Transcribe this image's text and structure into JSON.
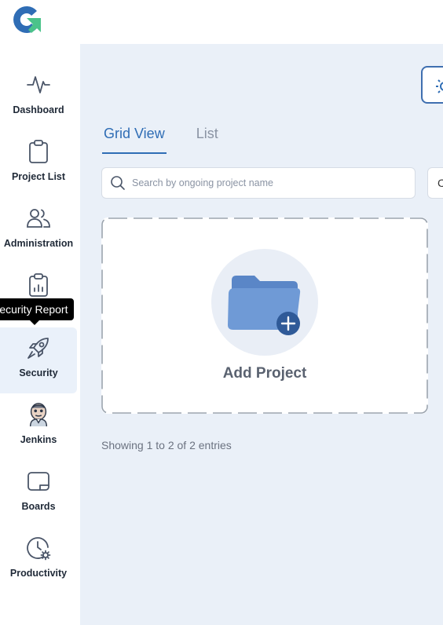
{
  "sidebar": {
    "items": [
      {
        "label": "Dashboard",
        "icon": "activity-icon"
      },
      {
        "label": "Project List",
        "icon": "clipboard-icon"
      },
      {
        "label": "Administration",
        "icon": "users-icon"
      },
      {
        "label": "",
        "icon": "clipboard-chart-icon"
      },
      {
        "label": "Security",
        "icon": "rocket-icon"
      },
      {
        "label": "Jenkins",
        "icon": "jenkins-icon"
      },
      {
        "label": "Boards",
        "icon": "board-icon"
      },
      {
        "label": "Productivity",
        "icon": "clock-gear-icon"
      }
    ],
    "tooltip": "Security Report"
  },
  "main": {
    "tabs": [
      {
        "label": "Grid View",
        "active": true
      },
      {
        "label": "List",
        "active": false
      }
    ],
    "search": {
      "placeholder": "Search by ongoing project name",
      "value": ""
    },
    "filter_label": "C",
    "add_project_label": "Add Project",
    "entries_text": "Showing 1 to 2 of 2 entries"
  },
  "colors": {
    "accent": "#2f6db5",
    "main_bg": "#eaf0f8",
    "active_nav_bg": "#eaf1fa",
    "logo_blue": "#2f6db5",
    "logo_green": "#4bc38a"
  }
}
